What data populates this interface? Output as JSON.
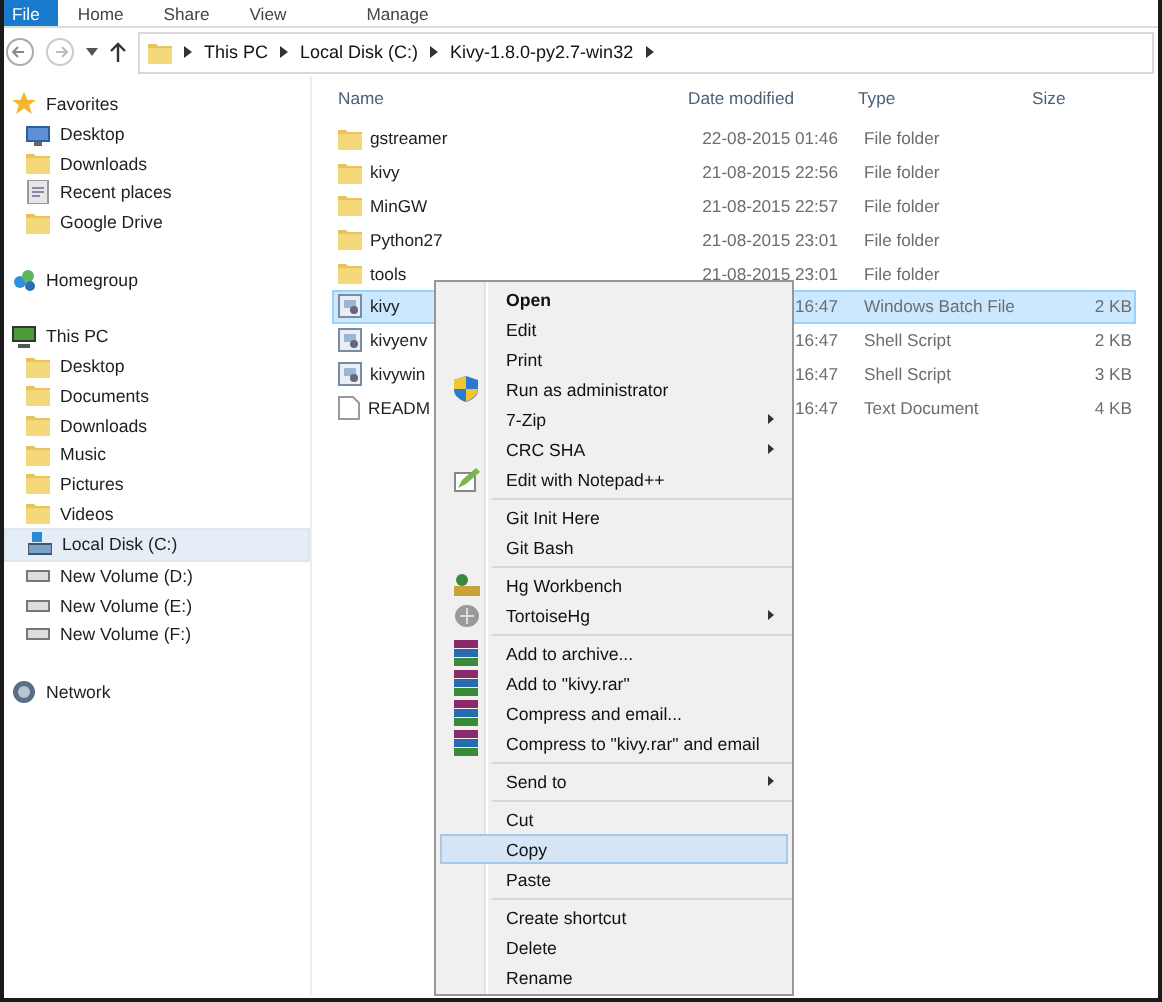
{
  "ribbon_tabs": [
    {
      "label": "File",
      "selected": true
    },
    {
      "label": "Home",
      "selected": false
    },
    {
      "label": "Share",
      "selected": false
    },
    {
      "label": "View",
      "selected": false
    },
    {
      "label": "Manage",
      "selected": false
    }
  ],
  "address": {
    "crumbs": [
      "This PC",
      "Local Disk (C:)",
      "Kivy-1.8.0-py2.7-win32"
    ]
  },
  "sidebar": {
    "sections": [
      {
        "label": "Favorites",
        "kind": "star",
        "items": [
          {
            "label": "Desktop",
            "kind": "monitor",
            "selected": false
          },
          {
            "label": "Downloads",
            "kind": "folder",
            "selected": false
          },
          {
            "label": "Recent places",
            "kind": "recent",
            "selected": false
          },
          {
            "label": "Google Drive",
            "kind": "folder",
            "selected": false
          }
        ]
      },
      {
        "label": "Homegroup",
        "kind": "homegroup"
      },
      {
        "label": "This PC",
        "kind": "pc",
        "items": [
          {
            "label": "Desktop",
            "kind": "folder",
            "selected": false
          },
          {
            "label": "Documents",
            "kind": "folder",
            "selected": false
          },
          {
            "label": "Downloads",
            "kind": "folder",
            "selected": false
          },
          {
            "label": "Music",
            "kind": "folder",
            "selected": false
          },
          {
            "label": "Pictures",
            "kind": "folder",
            "selected": false
          },
          {
            "label": "Videos",
            "kind": "folder",
            "selected": false
          },
          {
            "label": "Local Disk (C:)",
            "kind": "disk",
            "selected": true
          },
          {
            "label": "New Volume (D:)",
            "kind": "drive",
            "selected": false
          },
          {
            "label": "New Volume (E:)",
            "kind": "drive",
            "selected": false
          },
          {
            "label": "New Volume (F:)",
            "kind": "drive",
            "selected": false
          }
        ]
      },
      {
        "label": "Network",
        "kind": "network"
      }
    ]
  },
  "columns": [
    "Name",
    "Date modified",
    "Type",
    "Size"
  ],
  "files": [
    {
      "name": "gstreamer",
      "date": "22-08-2015 01:46",
      "type": "File folder",
      "kind": "folder",
      "selected": false
    },
    {
      "name": "kivy",
      "date": "21-08-2015 22:56",
      "type": "File folder",
      "kind": "folder",
      "selected": false
    },
    {
      "name": "MinGW",
      "date": "21-08-2015 22:57",
      "type": "File folder",
      "kind": "folder",
      "selected": false
    },
    {
      "name": "Python27",
      "date": "21-08-2015 23:01",
      "type": "File folder",
      "kind": "folder",
      "selected": false
    },
    {
      "name": "tools",
      "date": "21-08-2015 23:01",
      "type": "File folder",
      "kind": "folder",
      "selected": false
    },
    {
      "name": "kivy",
      "date": "16:47",
      "type": "Windows Batch File",
      "size": "2 KB",
      "kind": "script",
      "selected": true
    },
    {
      "name": "kivyenv",
      "date": "16:47",
      "type": "Shell Script",
      "size": "2 KB",
      "kind": "script",
      "selected": false
    },
    {
      "name": "kivywin",
      "date": "16:47",
      "type": "Shell Script",
      "size": "3 KB",
      "kind": "script",
      "selected": false
    },
    {
      "name": "READM",
      "date": "16:47",
      "type": "Text Document",
      "size": "4 KB",
      "kind": "text",
      "selected": false
    }
  ],
  "context_menu": {
    "sections": [
      [
        {
          "label": "Open",
          "default": true,
          "submenu": false,
          "selected": false
        },
        {
          "label": "Edit",
          "default": false,
          "submenu": false,
          "selected": false
        },
        {
          "label": "Print",
          "default": false,
          "submenu": false,
          "selected": false
        },
        {
          "label": "Run as administrator",
          "kind": "shield",
          "default": false,
          "submenu": false,
          "selected": false
        },
        {
          "label": "7-Zip",
          "default": false,
          "submenu": true,
          "selected": false
        },
        {
          "label": "CRC SHA",
          "default": false,
          "submenu": true,
          "selected": false
        },
        {
          "label": "Edit with Notepad++",
          "kind": "notepad",
          "default": false,
          "submenu": false,
          "selected": false
        }
      ],
      [
        {
          "label": "Git Init Here",
          "default": false,
          "submenu": false,
          "selected": false
        },
        {
          "label": "Git Bash",
          "default": false,
          "submenu": false,
          "selected": false
        }
      ],
      [
        {
          "label": "Hg Workbench",
          "kind": "hg",
          "default": false,
          "submenu": false,
          "selected": false
        },
        {
          "label": "TortoiseHg",
          "kind": "tortoise",
          "default": false,
          "submenu": true,
          "selected": false
        }
      ],
      [
        {
          "label": "Add to archive...",
          "kind": "archive",
          "default": false,
          "submenu": false,
          "selected": false
        },
        {
          "label": "Add to \"kivy.rar\"",
          "kind": "archive",
          "default": false,
          "submenu": false,
          "selected": false
        },
        {
          "label": "Compress and email...",
          "kind": "archive",
          "default": false,
          "submenu": false,
          "selected": false
        },
        {
          "label": "Compress to \"kivy.rar\" and email",
          "kind": "archive",
          "default": false,
          "submenu": false,
          "selected": false
        }
      ],
      [
        {
          "label": "Send to",
          "default": false,
          "submenu": true,
          "selected": false
        }
      ],
      [
        {
          "label": "Cut",
          "default": false,
          "submenu": false,
          "selected": false
        },
        {
          "label": "Copy",
          "default": false,
          "submenu": false,
          "selected": true
        },
        {
          "label": "Paste",
          "default": false,
          "submenu": false,
          "selected": false
        }
      ],
      [
        {
          "label": "Create shortcut",
          "default": false,
          "submenu": false,
          "selected": false
        },
        {
          "label": "Delete",
          "default": false,
          "submenu": false,
          "selected": false
        },
        {
          "label": "Rename",
          "default": false,
          "submenu": false,
          "selected": false
        }
      ]
    ]
  }
}
